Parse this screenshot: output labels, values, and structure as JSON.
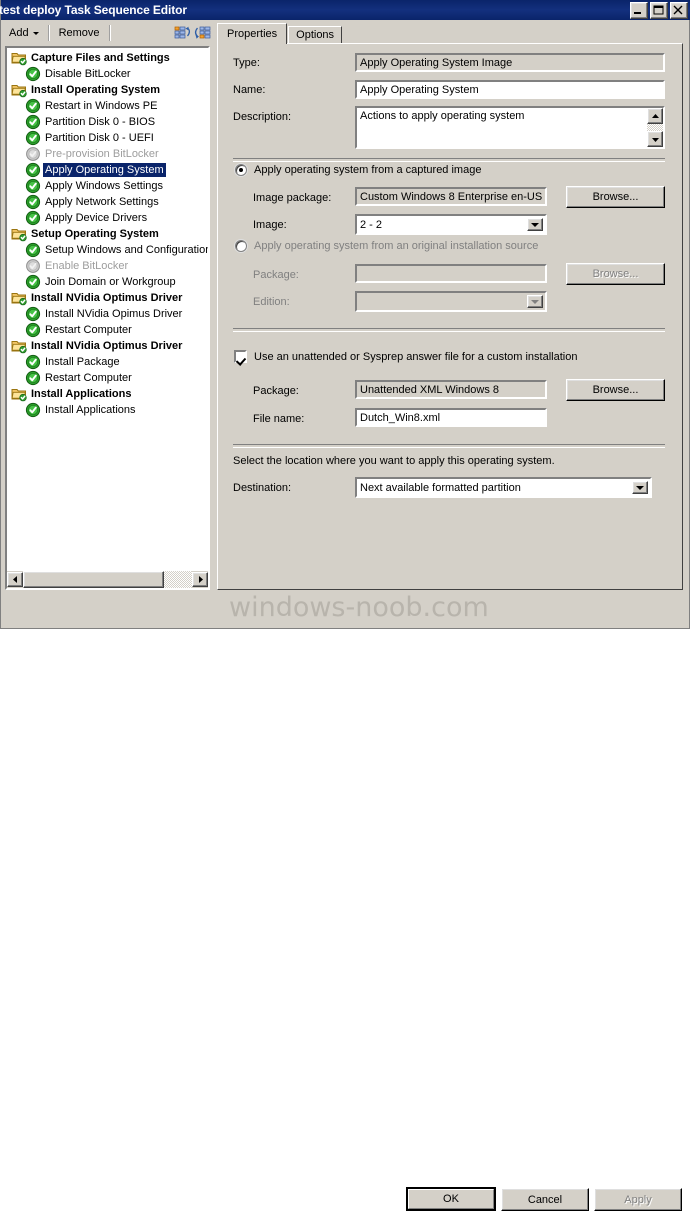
{
  "window": {
    "title": "test deploy Task Sequence Editor",
    "minimize_label": "Minimize",
    "maximize_label": "Maximize",
    "close_label": "Close"
  },
  "toolbar": {
    "add_label": "Add",
    "remove_label": "Remove",
    "move_up_icon": "move-up-icon",
    "move_down_icon": "move-down-icon"
  },
  "tree": {
    "items": [
      {
        "label": "Capture Files and Settings",
        "type": "folder",
        "indent": 0,
        "state": "enabled",
        "selected": false
      },
      {
        "label": "Disable BitLocker",
        "type": "step",
        "indent": 1,
        "state": "enabled",
        "selected": false
      },
      {
        "label": "Install Operating System",
        "type": "folder",
        "indent": 0,
        "state": "enabled",
        "selected": false
      },
      {
        "label": "Restart in Windows PE",
        "type": "step",
        "indent": 1,
        "state": "enabled",
        "selected": false
      },
      {
        "label": "Partition Disk 0 - BIOS",
        "type": "step",
        "indent": 1,
        "state": "enabled",
        "selected": false
      },
      {
        "label": "Partition Disk 0 - UEFI",
        "type": "step",
        "indent": 1,
        "state": "enabled",
        "selected": false
      },
      {
        "label": "Pre-provision BitLocker",
        "type": "step",
        "indent": 1,
        "state": "disabled",
        "selected": false
      },
      {
        "label": "Apply Operating System",
        "type": "step",
        "indent": 1,
        "state": "enabled",
        "selected": true
      },
      {
        "label": "Apply Windows Settings",
        "type": "step",
        "indent": 1,
        "state": "enabled",
        "selected": false
      },
      {
        "label": "Apply Network Settings",
        "type": "step",
        "indent": 1,
        "state": "enabled",
        "selected": false
      },
      {
        "label": "Apply Device Drivers",
        "type": "step",
        "indent": 1,
        "state": "enabled",
        "selected": false
      },
      {
        "label": "Setup Operating System",
        "type": "folder",
        "indent": 0,
        "state": "enabled",
        "selected": false
      },
      {
        "label": "Setup Windows and Configuration",
        "type": "step",
        "indent": 1,
        "state": "enabled",
        "selected": false
      },
      {
        "label": "Enable BitLocker",
        "type": "step",
        "indent": 1,
        "state": "disabled",
        "selected": false
      },
      {
        "label": "Join Domain or Workgroup",
        "type": "step",
        "indent": 1,
        "state": "enabled",
        "selected": false
      },
      {
        "label": "Install NVidia Optimus Driver",
        "type": "folder",
        "indent": 0,
        "state": "enabled",
        "selected": false
      },
      {
        "label": "Install NVidia Opimus Driver",
        "type": "step",
        "indent": 1,
        "state": "enabled",
        "selected": false
      },
      {
        "label": "Restart Computer",
        "type": "step",
        "indent": 1,
        "state": "enabled",
        "selected": false
      },
      {
        "label": "Install NVidia Optimus Driver",
        "type": "folder",
        "indent": 0,
        "state": "enabled",
        "selected": false
      },
      {
        "label": "Install Package",
        "type": "step",
        "indent": 1,
        "state": "enabled",
        "selected": false
      },
      {
        "label": "Restart Computer",
        "type": "step",
        "indent": 1,
        "state": "enabled",
        "selected": false
      },
      {
        "label": "Install Applications",
        "type": "folder",
        "indent": 0,
        "state": "enabled",
        "selected": false
      },
      {
        "label": "Install Applications",
        "type": "step",
        "indent": 1,
        "state": "enabled",
        "selected": false
      }
    ]
  },
  "tabs": [
    {
      "label": "Properties",
      "active": true
    },
    {
      "label": "Options",
      "active": false
    }
  ],
  "properties": {
    "type_label": "Type:",
    "type_value": "Apply Operating System Image",
    "name_label": "Name:",
    "name_value": "Apply Operating System",
    "description_label": "Description:",
    "description_value": "Actions to apply operating system",
    "captured": {
      "radio_label": "Apply operating system from a captured image",
      "selected": true,
      "image_package_label": "Image package:",
      "image_package_value": "Custom Windows 8 Enterprise  en-US",
      "image_package_browse": "Browse...",
      "image_label": "Image:",
      "image_value": "2 - 2"
    },
    "original": {
      "radio_label": "Apply operating system from an original installation source",
      "selected": false,
      "package_label": "Package:",
      "package_value": "",
      "package_browse": "Browse...",
      "edition_label": "Edition:",
      "edition_value": ""
    },
    "unattend": {
      "checkbox_label": "Use an unattended or Sysprep answer file for a custom installation",
      "checked": true,
      "package_label": "Package:",
      "package_value": "Unattended XML Windows 8",
      "package_browse": "Browse...",
      "filename_label": "File name:",
      "filename_value": "Dutch_Win8.xml"
    },
    "location": {
      "hint": "Select the location where you want to apply this operating system.",
      "destination_label": "Destination:",
      "destination_value": "Next available formatted partition"
    }
  },
  "footer": {
    "ok_label": "OK",
    "cancel_label": "Cancel",
    "apply_label": "Apply",
    "apply_enabled": false
  },
  "watermark": {
    "text": "windows-noob.com"
  },
  "colors": {
    "title_bar": "#0a246a",
    "face": "#d4d0c8",
    "selection": "#0a246a",
    "disabled_text": "#9d9d9d"
  }
}
